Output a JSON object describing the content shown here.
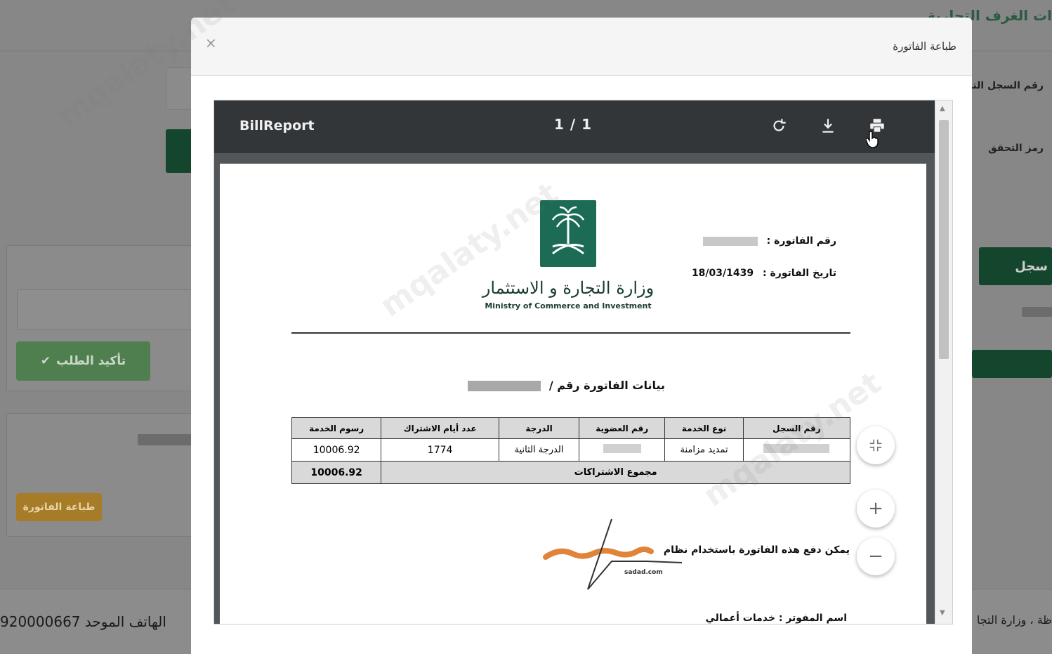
{
  "background": {
    "page_title": "ات الغرف التجارية",
    "field_cr_label": "رقم السجل التجار",
    "field_code_label": "رمز التحقق",
    "register_button_label": "سجل",
    "confirm_button_label": "تأكيد الطلب",
    "print_button_label": "طباعة الفاتورة",
    "footer_phone": "الهاتف الموحد 920000667",
    "footer_right": "ظة ، وزارة التجا"
  },
  "modal": {
    "title": "طباعة الفاتورة",
    "close_label": "×"
  },
  "viewer": {
    "document_title": "BillReport",
    "page_indicator": "1 / 1",
    "icons": [
      "rotate-icon",
      "download-icon",
      "print-icon"
    ],
    "zoom_controls": {
      "fit": "⛶",
      "zoom_in": "+",
      "zoom_out": "−"
    }
  },
  "invoice": {
    "ministry_name_ar": "وزارة التجارة و الاستثمار",
    "ministry_name_en": "Ministry of Commerce and Investment",
    "invoice_number_label": "رقم الفاتورة",
    "invoice_date_label": "تاريخ الفاتورة",
    "invoice_date_value": "18/03/1439",
    "heading": "بيانات الفاتورة رقم /",
    "table": {
      "headers": [
        "رقم السجل",
        "نوع الخدمة",
        "رقم العضوية",
        "الدرجة",
        "عدد أيام الاشتراك",
        "رسوم الخدمة"
      ],
      "rows": [
        [
          "",
          "تمديد مزامنة",
          "",
          "الدرجة الثانية",
          "1774",
          "10006.92"
        ]
      ],
      "total_label": "مجموع الاشتراكات",
      "total_value": "10006.92"
    },
    "payment_note": "يمكن دفع هذه الفاتورة باستخدام نظام",
    "sadad_caption": "sadad.com",
    "biller_line": "اسم المفوتر : خدمات أعمالي"
  },
  "colors": {
    "toolbar": "#323639",
    "brand_green": "#1b6b55",
    "sadad_orange": "#e0843a"
  }
}
